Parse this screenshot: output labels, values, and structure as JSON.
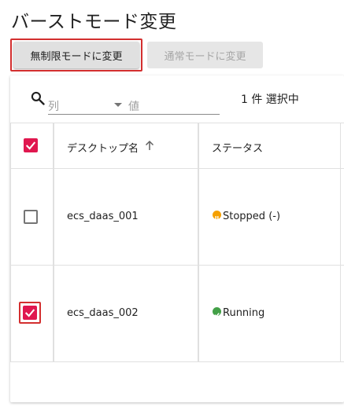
{
  "page": {
    "title": "バーストモード変更"
  },
  "toolbar": {
    "unlimited_label": "無制限モードに変更",
    "normal_label": "通常モードに変更"
  },
  "filter": {
    "column_placeholder": "列",
    "value_placeholder": "値"
  },
  "selection": {
    "count_text": "1 件 選択中"
  },
  "table": {
    "columns": [
      "デスクトップ名",
      "ステータス"
    ],
    "rows": [
      {
        "name": "ecs_daas_001",
        "status": "Stopped (-)",
        "status_type": "stopped",
        "selected": false
      },
      {
        "name": "ecs_daas_002",
        "status": "Running",
        "status_type": "running",
        "selected": true
      }
    ]
  },
  "colors": {
    "accent": "#e0174f",
    "highlight_border": "#d32f2f",
    "stopped": "#f5a000",
    "running": "#43a047",
    "disabled_text": "#a6a6a6"
  },
  "icons": {
    "search": "search-icon",
    "sort": "arrow-up-icon",
    "dropdown": "chevron-down-icon",
    "stopped": "pause-circle-icon",
    "running": "check-circle-icon"
  }
}
